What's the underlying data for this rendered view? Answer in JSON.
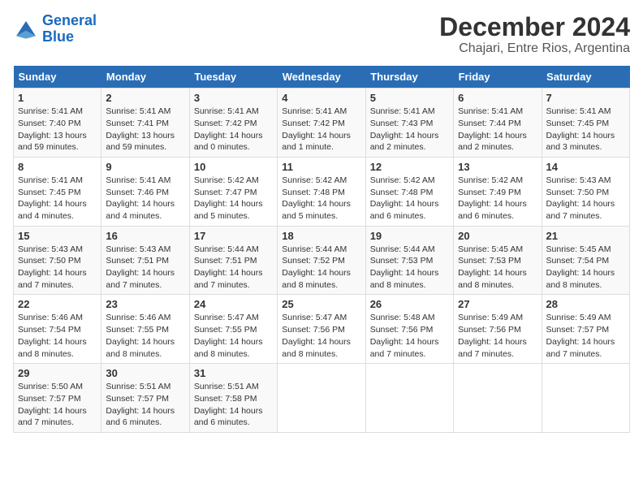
{
  "header": {
    "logo_line1": "General",
    "logo_line2": "Blue",
    "month": "December 2024",
    "location": "Chajari, Entre Rios, Argentina"
  },
  "weekdays": [
    "Sunday",
    "Monday",
    "Tuesday",
    "Wednesday",
    "Thursday",
    "Friday",
    "Saturday"
  ],
  "weeks": [
    [
      {
        "day": "1",
        "info": "Sunrise: 5:41 AM\nSunset: 7:40 PM\nDaylight: 13 hours\nand 59 minutes."
      },
      {
        "day": "2",
        "info": "Sunrise: 5:41 AM\nSunset: 7:41 PM\nDaylight: 13 hours\nand 59 minutes."
      },
      {
        "day": "3",
        "info": "Sunrise: 5:41 AM\nSunset: 7:42 PM\nDaylight: 14 hours\nand 0 minutes."
      },
      {
        "day": "4",
        "info": "Sunrise: 5:41 AM\nSunset: 7:42 PM\nDaylight: 14 hours\nand 1 minute."
      },
      {
        "day": "5",
        "info": "Sunrise: 5:41 AM\nSunset: 7:43 PM\nDaylight: 14 hours\nand 2 minutes."
      },
      {
        "day": "6",
        "info": "Sunrise: 5:41 AM\nSunset: 7:44 PM\nDaylight: 14 hours\nand 2 minutes."
      },
      {
        "day": "7",
        "info": "Sunrise: 5:41 AM\nSunset: 7:45 PM\nDaylight: 14 hours\nand 3 minutes."
      }
    ],
    [
      {
        "day": "8",
        "info": "Sunrise: 5:41 AM\nSunset: 7:45 PM\nDaylight: 14 hours\nand 4 minutes."
      },
      {
        "day": "9",
        "info": "Sunrise: 5:41 AM\nSunset: 7:46 PM\nDaylight: 14 hours\nand 4 minutes."
      },
      {
        "day": "10",
        "info": "Sunrise: 5:42 AM\nSunset: 7:47 PM\nDaylight: 14 hours\nand 5 minutes."
      },
      {
        "day": "11",
        "info": "Sunrise: 5:42 AM\nSunset: 7:48 PM\nDaylight: 14 hours\nand 5 minutes."
      },
      {
        "day": "12",
        "info": "Sunrise: 5:42 AM\nSunset: 7:48 PM\nDaylight: 14 hours\nand 6 minutes."
      },
      {
        "day": "13",
        "info": "Sunrise: 5:42 AM\nSunset: 7:49 PM\nDaylight: 14 hours\nand 6 minutes."
      },
      {
        "day": "14",
        "info": "Sunrise: 5:43 AM\nSunset: 7:50 PM\nDaylight: 14 hours\nand 7 minutes."
      }
    ],
    [
      {
        "day": "15",
        "info": "Sunrise: 5:43 AM\nSunset: 7:50 PM\nDaylight: 14 hours\nand 7 minutes."
      },
      {
        "day": "16",
        "info": "Sunrise: 5:43 AM\nSunset: 7:51 PM\nDaylight: 14 hours\nand 7 minutes."
      },
      {
        "day": "17",
        "info": "Sunrise: 5:44 AM\nSunset: 7:51 PM\nDaylight: 14 hours\nand 7 minutes."
      },
      {
        "day": "18",
        "info": "Sunrise: 5:44 AM\nSunset: 7:52 PM\nDaylight: 14 hours\nand 8 minutes."
      },
      {
        "day": "19",
        "info": "Sunrise: 5:44 AM\nSunset: 7:53 PM\nDaylight: 14 hours\nand 8 minutes."
      },
      {
        "day": "20",
        "info": "Sunrise: 5:45 AM\nSunset: 7:53 PM\nDaylight: 14 hours\nand 8 minutes."
      },
      {
        "day": "21",
        "info": "Sunrise: 5:45 AM\nSunset: 7:54 PM\nDaylight: 14 hours\nand 8 minutes."
      }
    ],
    [
      {
        "day": "22",
        "info": "Sunrise: 5:46 AM\nSunset: 7:54 PM\nDaylight: 14 hours\nand 8 minutes."
      },
      {
        "day": "23",
        "info": "Sunrise: 5:46 AM\nSunset: 7:55 PM\nDaylight: 14 hours\nand 8 minutes."
      },
      {
        "day": "24",
        "info": "Sunrise: 5:47 AM\nSunset: 7:55 PM\nDaylight: 14 hours\nand 8 minutes."
      },
      {
        "day": "25",
        "info": "Sunrise: 5:47 AM\nSunset: 7:56 PM\nDaylight: 14 hours\nand 8 minutes."
      },
      {
        "day": "26",
        "info": "Sunrise: 5:48 AM\nSunset: 7:56 PM\nDaylight: 14 hours\nand 7 minutes."
      },
      {
        "day": "27",
        "info": "Sunrise: 5:49 AM\nSunset: 7:56 PM\nDaylight: 14 hours\nand 7 minutes."
      },
      {
        "day": "28",
        "info": "Sunrise: 5:49 AM\nSunset: 7:57 PM\nDaylight: 14 hours\nand 7 minutes."
      }
    ],
    [
      {
        "day": "29",
        "info": "Sunrise: 5:50 AM\nSunset: 7:57 PM\nDaylight: 14 hours\nand 7 minutes."
      },
      {
        "day": "30",
        "info": "Sunrise: 5:51 AM\nSunset: 7:57 PM\nDaylight: 14 hours\nand 6 minutes."
      },
      {
        "day": "31",
        "info": "Sunrise: 5:51 AM\nSunset: 7:58 PM\nDaylight: 14 hours\nand 6 minutes."
      },
      null,
      null,
      null,
      null
    ]
  ]
}
